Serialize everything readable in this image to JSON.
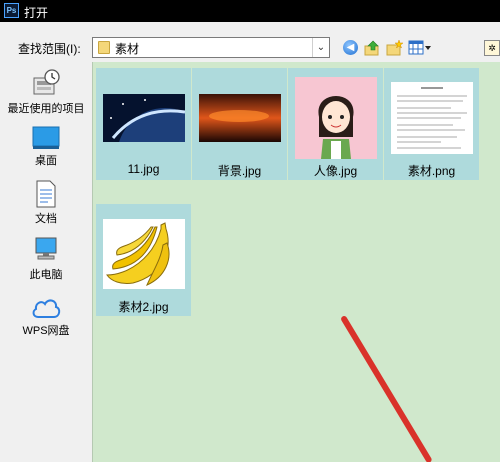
{
  "window": {
    "title": "打开",
    "app_badge": "Ps"
  },
  "toolbar": {
    "lookin_label": "查找范围(I):",
    "lookin_value": "素材"
  },
  "places": [
    {
      "label": "最近使用的项目",
      "icon": "recent-items-icon"
    },
    {
      "label": "桌面",
      "icon": "desktop-icon"
    },
    {
      "label": "文档",
      "icon": "documents-icon"
    },
    {
      "label": "此电脑",
      "icon": "this-pc-icon"
    },
    {
      "label": "WPS网盘",
      "icon": "wps-cloud-icon"
    }
  ],
  "files": [
    {
      "name": "11.jpg",
      "thumb": "space-planet"
    },
    {
      "name": "背景.jpg",
      "thumb": "sunset-sky"
    },
    {
      "name": "人像.jpg",
      "thumb": "cartoon-girl"
    },
    {
      "name": "素材.png",
      "thumb": "text-document"
    },
    {
      "name": "素材2.jpg",
      "thumb": "bananas"
    }
  ],
  "colors": {
    "file_pane_bg": "#d0e8cc",
    "tile_bg": "#aedadc",
    "annotation_arrow": "#d9322a"
  }
}
